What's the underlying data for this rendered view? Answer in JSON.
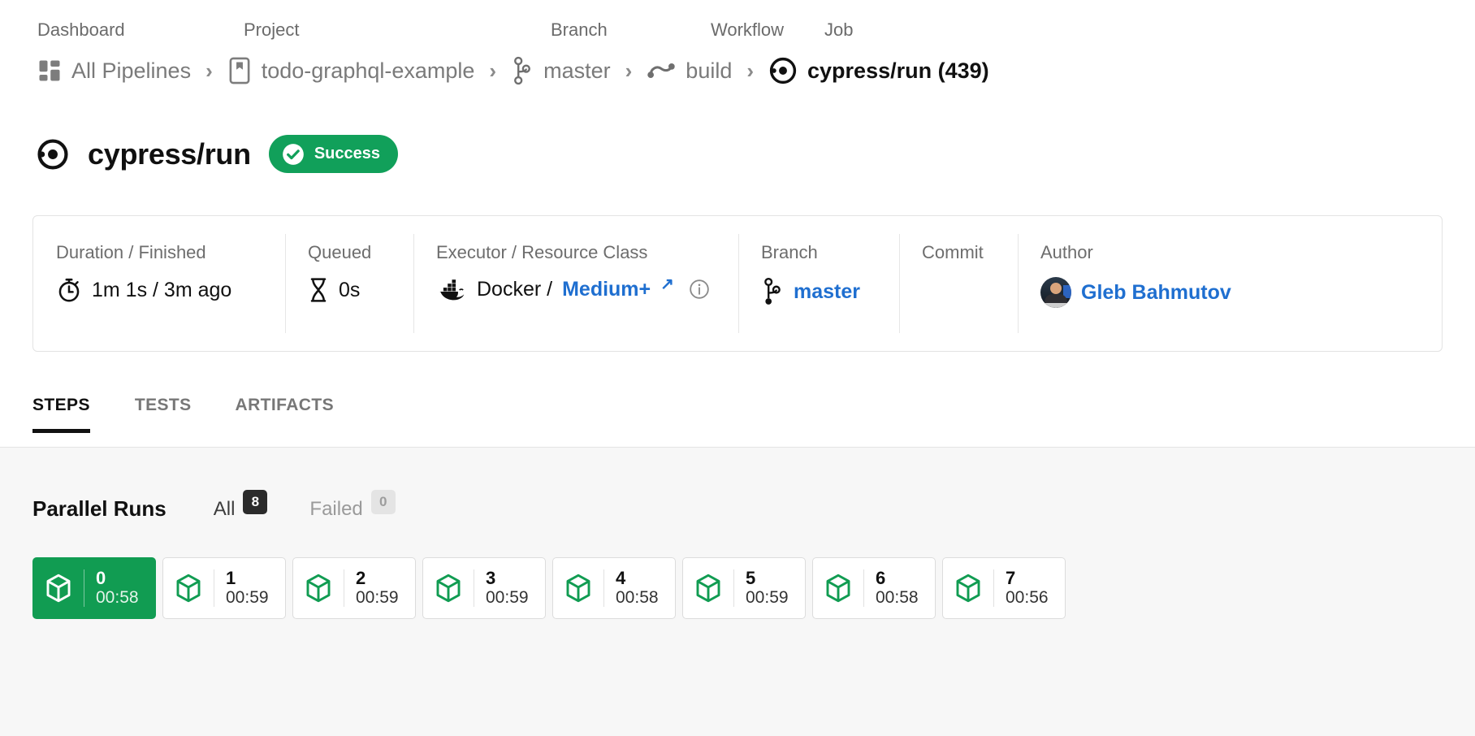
{
  "breadcrumb": {
    "groups": [
      {
        "label": "Dashboard",
        "text": "All Pipelines",
        "icon": "grid-icon",
        "current": false
      },
      {
        "label": "Project",
        "text": "todo-graphql-example",
        "icon": "bookmark-icon",
        "current": false
      },
      {
        "label": "Branch",
        "text": "master",
        "icon": "branch-icon",
        "current": false
      },
      {
        "label": "Workflow",
        "text": "build",
        "icon": "workflow-icon",
        "current": false
      },
      {
        "label": "Job",
        "text": "cypress/run (439)",
        "icon": "job-icon",
        "current": true
      }
    ],
    "separator": "›"
  },
  "header": {
    "job_icon": "job-icon",
    "title": "cypress/run",
    "status": {
      "label": "Success",
      "icon": "check-circle-icon",
      "color": "#11a05a"
    }
  },
  "info_card": {
    "cells": [
      {
        "key": "duration",
        "label": "Duration / Finished",
        "value": "1m 1s / 3m ago",
        "icon": "stopwatch-icon"
      },
      {
        "key": "queued",
        "label": "Queued",
        "value": "0s",
        "icon": "hourglass-icon"
      },
      {
        "key": "executor",
        "label": "Executor / Resource Class",
        "value": "Docker /",
        "link": "Medium+",
        "icon": "docker-icon",
        "external": "↗",
        "info": "info-icon"
      },
      {
        "key": "branch",
        "label": "Branch",
        "value": "",
        "link": "master",
        "icon": "branch-icon"
      },
      {
        "key": "commit",
        "label": "Commit",
        "value": ""
      },
      {
        "key": "author",
        "label": "Author",
        "value": "",
        "link": "Gleb Bahmutov",
        "icon": "avatar"
      }
    ],
    "link_color": "#1f6fd0"
  },
  "tabs": [
    {
      "label": "STEPS",
      "active": true
    },
    {
      "label": "TESTS",
      "active": false
    },
    {
      "label": "ARTIFACTS",
      "active": false
    }
  ],
  "parallel_runs": {
    "title": "Parallel Runs",
    "filters": [
      {
        "label": "All",
        "count": "8",
        "active": true
      },
      {
        "label": "Failed",
        "count": "0",
        "active": false
      }
    ],
    "runs": [
      {
        "index": "0",
        "duration": "00:58",
        "selected": true,
        "icon": "cube-icon"
      },
      {
        "index": "1",
        "duration": "00:59",
        "selected": false,
        "icon": "cube-icon"
      },
      {
        "index": "2",
        "duration": "00:59",
        "selected": false,
        "icon": "cube-icon"
      },
      {
        "index": "3",
        "duration": "00:59",
        "selected": false,
        "icon": "cube-icon"
      },
      {
        "index": "4",
        "duration": "00:58",
        "selected": false,
        "icon": "cube-icon"
      },
      {
        "index": "5",
        "duration": "00:59",
        "selected": false,
        "icon": "cube-icon"
      },
      {
        "index": "6",
        "duration": "00:58",
        "selected": false,
        "icon": "cube-icon"
      },
      {
        "index": "7",
        "duration": "00:56",
        "selected": false,
        "icon": "cube-icon"
      }
    ],
    "accent_color": "#119c52"
  }
}
